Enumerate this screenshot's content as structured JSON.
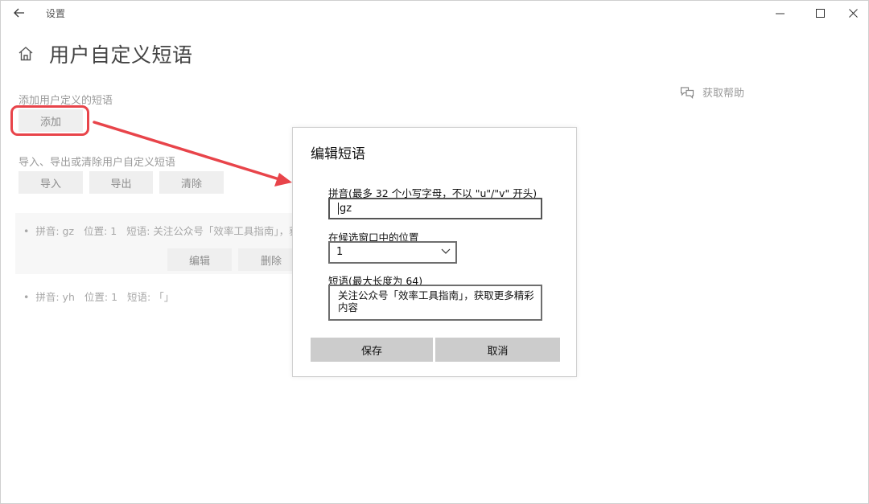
{
  "window": {
    "title": "设置"
  },
  "page": {
    "title": "用户自定义短语",
    "help_label": "获取帮助",
    "add_section_label": "添加用户定义的短语",
    "add_button": "添加",
    "io_section_label": "导入、导出或清除用户自定义短语",
    "import_button": "导入",
    "export_button": "导出",
    "clear_button": "清除"
  },
  "phrases": [
    {
      "pinyin": "拼音: gz",
      "position": "位置: 1",
      "phrase": "短语: 关注公众号「效率工具指南」，获",
      "edit_button": "编辑",
      "delete_button": "删除"
    },
    {
      "pinyin": "拼音: yh",
      "position": "位置: 1",
      "phrase": "短语: 「」"
    }
  ],
  "dialog": {
    "title": "编辑短语",
    "pinyin_label": "拼音(最多 32 个小写字母，不以 \"u\"/\"v\" 开头)",
    "pinyin_value": "gz",
    "position_label": "在候选窗口中的位置",
    "position_value": "1",
    "phrase_label": "短语(最大长度为 64)",
    "phrase_value": "关注公众号「效率工具指南」，获取更多精彩内容",
    "save_button": "保存",
    "cancel_button": "取消"
  },
  "colors": {
    "highlight": "#e8444a",
    "dialog_button": "#cccccc"
  }
}
